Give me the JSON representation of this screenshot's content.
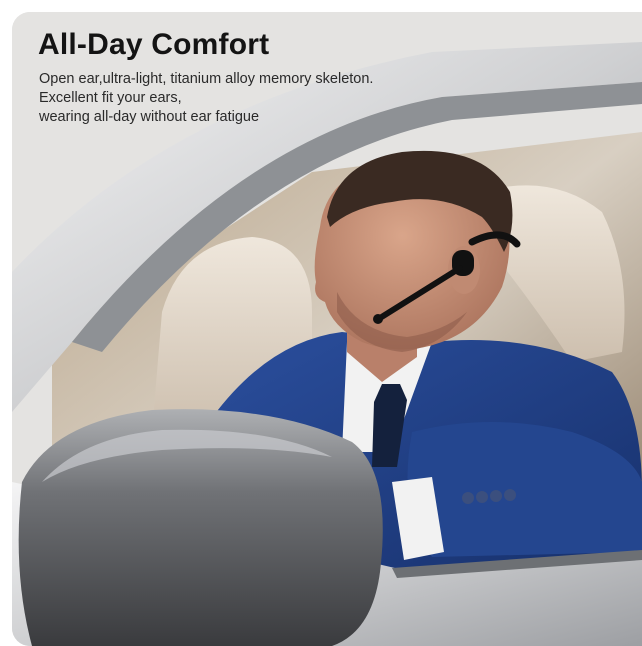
{
  "hero": {
    "headline": "All-Day Comfort",
    "lines": [
      "Open ear,ultra-light, titanium alloy memory skeleton.",
      "Excellent fit your ears,",
      "wearing all-day without ear fatigue"
    ]
  },
  "colors": {
    "headline": "#141414",
    "body_text": "#2a2a2a",
    "car_paint": "#cfd0d2",
    "suit": "#1f3f86",
    "shirt": "#f2f2f2",
    "tie": "#14213d",
    "headset": "#111111"
  }
}
